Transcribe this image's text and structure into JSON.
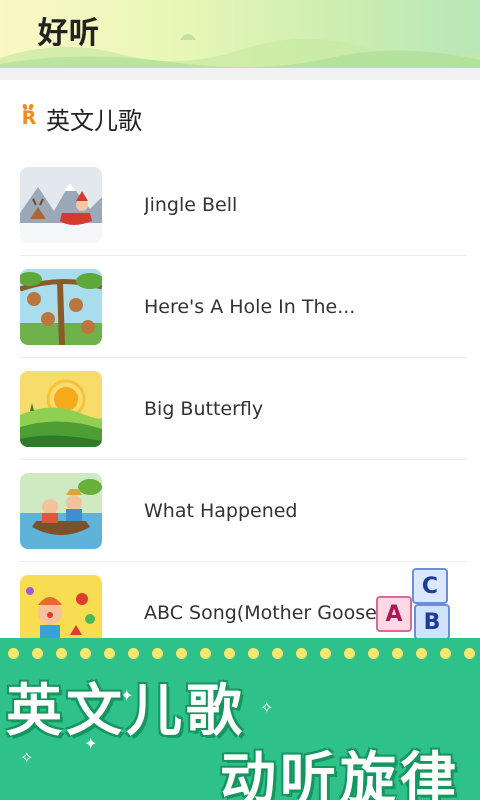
{
  "app": {
    "title": "好听"
  },
  "section": {
    "title": "英文儿歌",
    "icon": "r-logo-icon"
  },
  "songs": [
    {
      "title": "Jingle Bell",
      "thumb": "santa-sleigh-thumbnail"
    },
    {
      "title": "Here's A Hole In The...",
      "thumb": "monkeys-tree-thumbnail"
    },
    {
      "title": "Big Butterfly",
      "thumb": "sunset-hills-thumbnail"
    },
    {
      "title": "What Happened",
      "thumb": "kids-boat-thumbnail"
    },
    {
      "title": "ABC Song(Mother Goose...",
      "thumb": "clown-party-thumbnail"
    }
  ],
  "blocks": {
    "a": "A",
    "b": "B",
    "c": "C"
  },
  "promo": {
    "line1": "英文儿歌",
    "line2": "动听旋律"
  },
  "colors": {
    "promo_bg": "#2ec28a",
    "accent_orange": "#f08b1c",
    "dots": "#f5e66d"
  }
}
